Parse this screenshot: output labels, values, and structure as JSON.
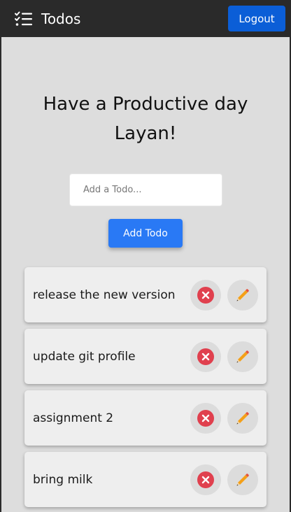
{
  "navbar": {
    "brand_icon": "checklist-icon",
    "title": "Todos",
    "logout_label": "Logout"
  },
  "main": {
    "greeting_line1": "Have a Productive day",
    "greeting_line2": "Layan!",
    "input_placeholder": "Add a Todo...",
    "input_value": "",
    "add_label": "Add Todo"
  },
  "todos": [
    {
      "text": "release the new version",
      "delete_icon": "delete-x-icon",
      "edit_icon": "pencil-icon"
    },
    {
      "text": "update git profile",
      "delete_icon": "delete-x-icon",
      "edit_icon": "pencil-icon"
    },
    {
      "text": "assignment 2",
      "delete_icon": "delete-x-icon",
      "edit_icon": "pencil-icon"
    },
    {
      "text": "bring milk",
      "delete_icon": "delete-x-icon",
      "edit_icon": "pencil-icon"
    }
  ],
  "colors": {
    "navbar_bg": "#2a2a2a",
    "logout_bg": "#0b5ed7",
    "add_button_bg": "#2979f5",
    "page_bg": "#dddddd",
    "card_bg": "#eeeeee",
    "delete_red": "#e0404e",
    "edit_orange": "#f4a018"
  }
}
